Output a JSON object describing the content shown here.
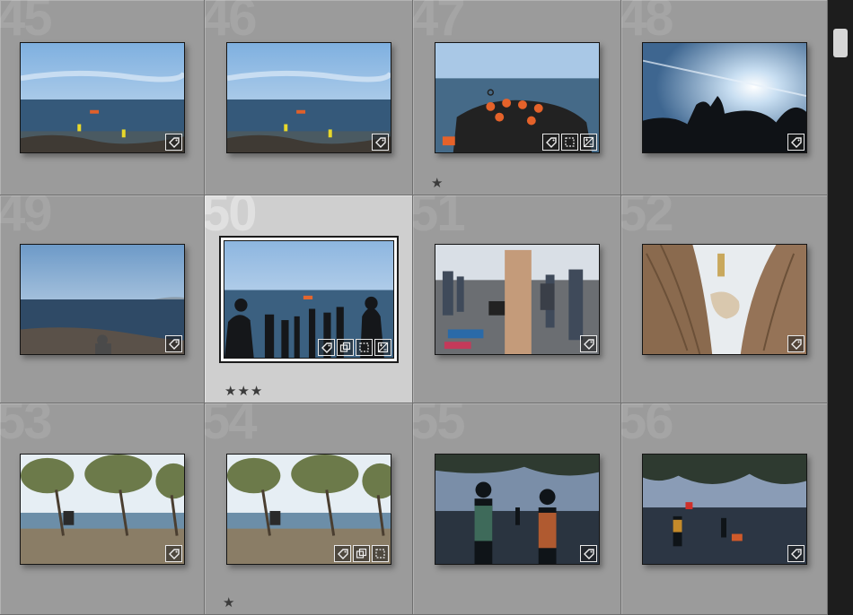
{
  "grid": {
    "cells": [
      {
        "number": "45",
        "scene": "sea-boat",
        "badges": [
          "keyword"
        ],
        "stars": "",
        "selected": false
      },
      {
        "number": "46",
        "scene": "sea-boat",
        "badges": [
          "keyword"
        ],
        "stars": "",
        "selected": false
      },
      {
        "number": "47",
        "scene": "crowded-raft",
        "badges": [
          "keyword",
          "crop",
          "develop"
        ],
        "stars": "★",
        "selected": false
      },
      {
        "number": "48",
        "scene": "sun-silhouettes",
        "badges": [
          "keyword"
        ],
        "stars": "",
        "selected": false
      },
      {
        "number": "49",
        "scene": "shore-horizon",
        "badges": [
          "keyword"
        ],
        "stars": "",
        "selected": false
      },
      {
        "number": "50",
        "scene": "beach-crowd",
        "badges": [
          "keyword",
          "collection",
          "crop",
          "develop"
        ],
        "stars": "★★★",
        "selected": true
      },
      {
        "number": "51",
        "scene": "rocky-beach",
        "badges": [
          "keyword"
        ],
        "stars": "",
        "selected": false
      },
      {
        "number": "52",
        "scene": "tree-trunks",
        "badges": [
          "keyword"
        ],
        "stars": "",
        "selected": false
      },
      {
        "number": "53",
        "scene": "trees-beach",
        "badges": [
          "keyword"
        ],
        "stars": "",
        "selected": false
      },
      {
        "number": "54",
        "scene": "trees-beach",
        "badges": [
          "keyword",
          "collection",
          "crop"
        ],
        "stars": "★",
        "selected": false
      },
      {
        "number": "55",
        "scene": "dusk-kids",
        "badges": [
          "keyword"
        ],
        "stars": "",
        "selected": false
      },
      {
        "number": "56",
        "scene": "dusk-wave",
        "badges": [
          "keyword"
        ],
        "stars": "",
        "selected": false
      }
    ]
  },
  "colors": {
    "cell_bg": "#9b9b9b",
    "selected_bg": "#cfcfcf",
    "scrollbar_track": "#1d1d1d",
    "scrollbar_thumb": "#d6d6d6"
  }
}
